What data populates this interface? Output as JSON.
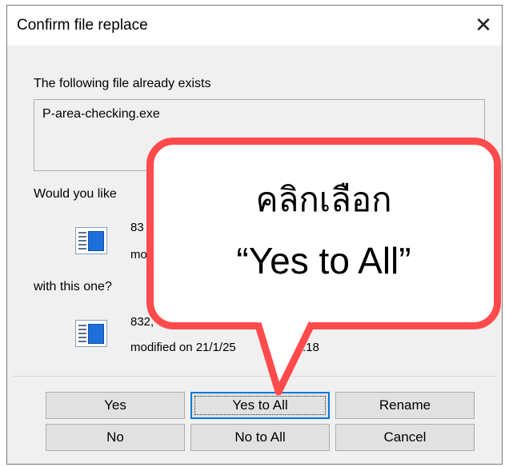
{
  "dialog": {
    "title": "Confirm file replace",
    "close_glyph": "✕",
    "exists_label": "The following file already exists",
    "filename": "P-area-checking.exe",
    "question": "Would you like",
    "existing_file": {
      "size": "83",
      "modified": "mo"
    },
    "with_label": "with this one?",
    "new_file": {
      "size": "832,",
      "modified": "modified on 21/1/25",
      "time": ":18"
    },
    "buttons": {
      "yes": "Yes",
      "yes_to_all": "Yes to All",
      "rename": "Rename",
      "no": "No",
      "no_to_all": "No to All",
      "cancel": "Cancel"
    }
  },
  "callout": {
    "line1": "คลิกเลือก",
    "line2": "“Yes to All”",
    "border_color": "#ff4b4b"
  },
  "colors": {
    "focus": "#0078d7",
    "icon_blue": "#1e6fd9"
  }
}
